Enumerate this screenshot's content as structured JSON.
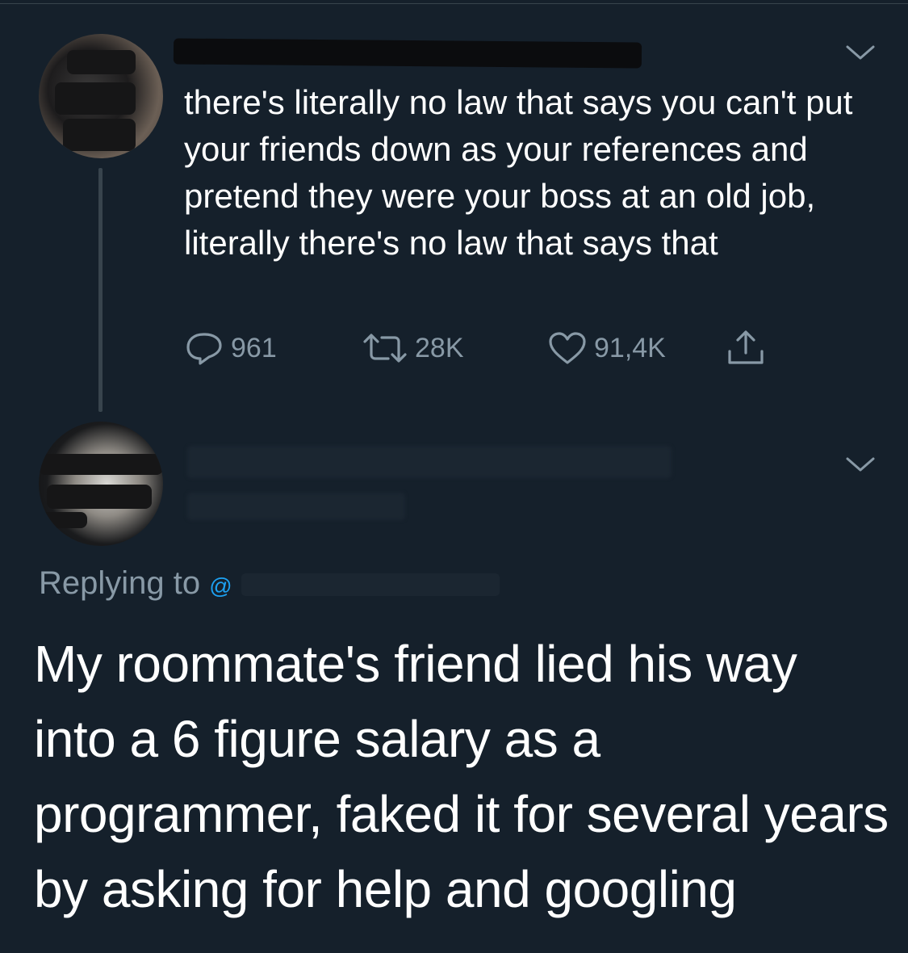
{
  "parent_tweet": {
    "text": "there's literally no law that says you can't put your friends down as your references and pretend they were your boss at an old job, literally there's no law that says that",
    "replies": "961",
    "retweets": "28K",
    "likes": "91,4K",
    "icons": [
      "reply-icon",
      "retweet-icon",
      "like-icon",
      "share-icon",
      "chevron-down-icon"
    ]
  },
  "reply_tweet": {
    "replying_label": "Replying to",
    "mention_prefix": "@",
    "text": "My roommate's friend lied his way into a 6 figure salary as a programmer, faked it for several years by asking for help and googling",
    "icons": [
      "chevron-down-icon"
    ]
  },
  "colors": {
    "background": "#15202b",
    "primary_text": "#ffffff",
    "secondary_text": "#8899a6",
    "link": "#1da1f2",
    "thread_line": "#38444d"
  }
}
